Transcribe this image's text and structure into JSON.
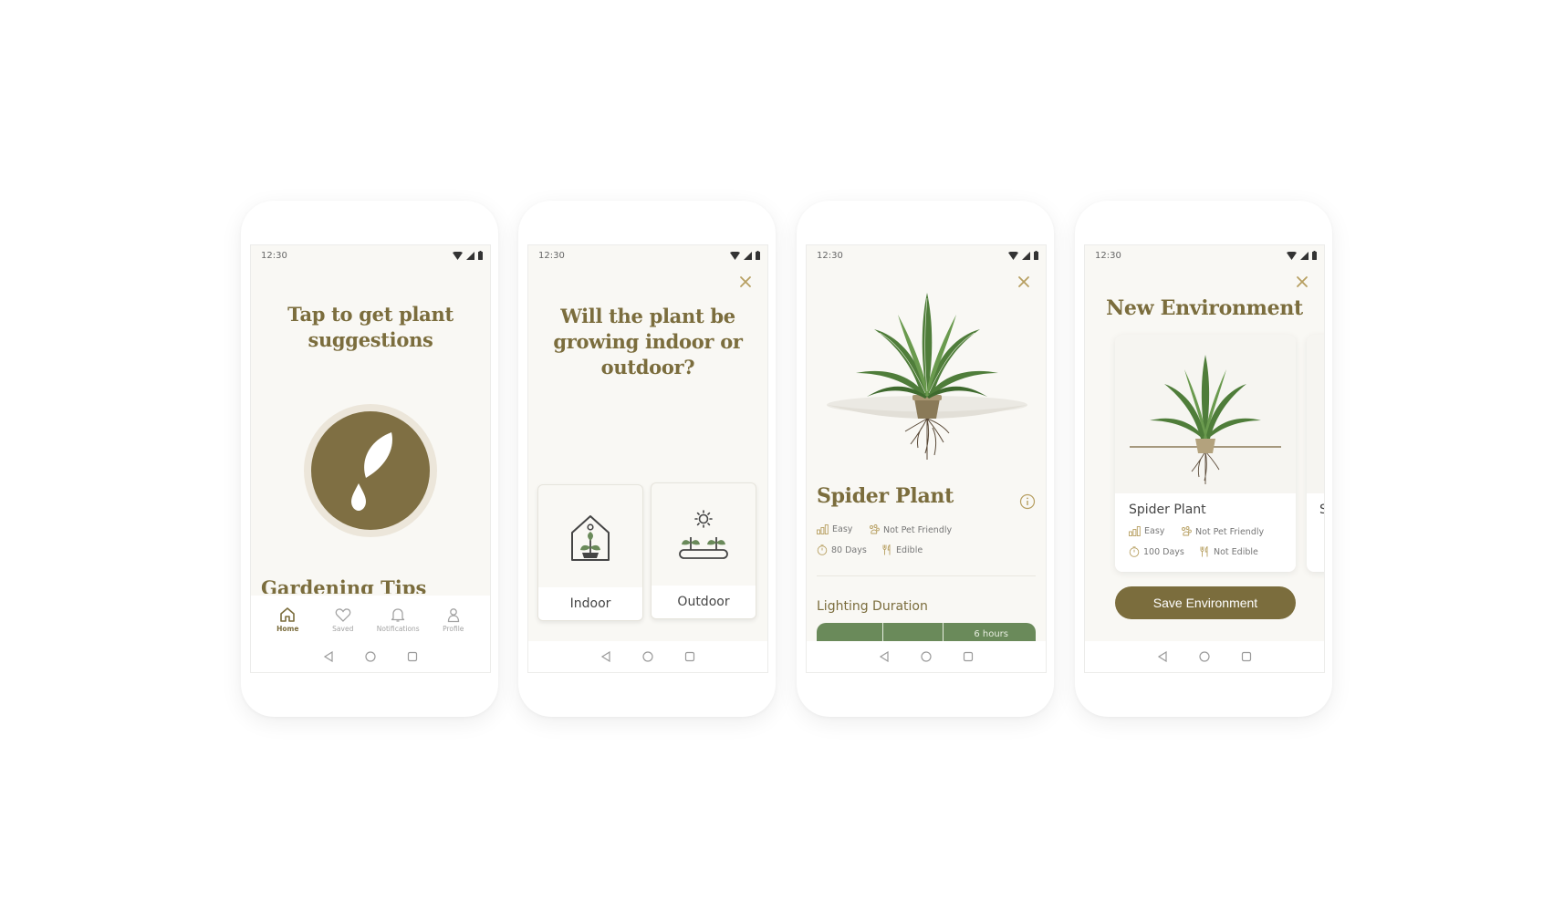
{
  "status": {
    "time": "12:30"
  },
  "screen1": {
    "title": "Tap to get plant suggestions",
    "section_title": "Gardening Tips",
    "tabs": [
      {
        "label": "Home",
        "icon": "home-icon",
        "active": true
      },
      {
        "label": "Saved",
        "icon": "heart-icon",
        "active": false
      },
      {
        "label": "Notifications",
        "icon": "bell-icon",
        "active": false
      },
      {
        "label": "Profile",
        "icon": "profile-icon",
        "active": false
      }
    ]
  },
  "screen2": {
    "title": "Will the plant be growing indoor or outdoor?",
    "options": [
      {
        "label": "Indoor",
        "icon": "indoor-house-plant-icon"
      },
      {
        "label": "Outdoor",
        "icon": "outdoor-sun-plants-icon"
      }
    ]
  },
  "screen3": {
    "plant_name": "Spider Plant",
    "difficulty": "Easy",
    "pet": "Not Pet Friendly",
    "days": "80 Days",
    "edible": "Edible",
    "section_title": "Lighting Duration",
    "lighting_value": "6 hours"
  },
  "screen4": {
    "title": "New Environment",
    "card": {
      "plant_name": "Spider Plant",
      "difficulty": "Easy",
      "pet": "Not Pet Friendly",
      "days": "100 Days",
      "edible": "Not Edible"
    },
    "peek_letter": "S",
    "save_label": "Save Environment"
  },
  "colors": {
    "accent": "#7b6d3d",
    "background": "#f9f8f4",
    "green": "#6a8a5a"
  }
}
